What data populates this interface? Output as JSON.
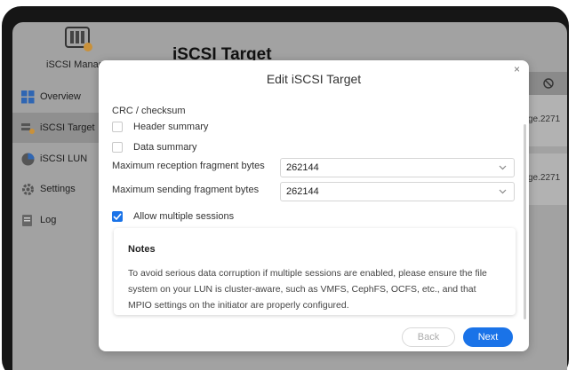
{
  "app": {
    "name": "iSCSI Manager",
    "page_title": "iSCSI Target"
  },
  "sidebar": {
    "items": [
      {
        "label": "Overview",
        "icon": "grid-icon"
      },
      {
        "label": "iSCSI Target",
        "icon": "target-icon",
        "active": true
      },
      {
        "label": "iSCSI LUN",
        "icon": "pie-icon"
      },
      {
        "label": "Settings",
        "icon": "gear-icon"
      },
      {
        "label": "Log",
        "icon": "log-icon"
      }
    ]
  },
  "background_list": {
    "rows": [
      "ge.2271",
      "ge.2271"
    ]
  },
  "dialog": {
    "title": "Edit iSCSI Target",
    "close_glyph": "×",
    "section_label": "CRC / checksum",
    "header_summary": {
      "label": "Header summary",
      "checked": false
    },
    "data_summary": {
      "label": "Data summary",
      "checked": false
    },
    "max_reception": {
      "label": "Maximum reception fragment bytes",
      "value": "262144"
    },
    "max_sending": {
      "label": "Maximum sending fragment bytes",
      "value": "262144"
    },
    "allow_multiple": {
      "label": "Allow multiple sessions",
      "checked": true
    },
    "notes": {
      "title": "Notes",
      "body": "To avoid serious data corruption if multiple sessions are enabled, please ensure the file system on your LUN is cluster-aware, such as VMFS, CephFS, OCFS, etc., and that MPIO settings on the initiator are properly configured."
    },
    "back_label": "Back",
    "next_label": "Next"
  },
  "colors": {
    "accent": "#1a73e8",
    "overlay": "#a2a2a2",
    "frame": "#161616"
  }
}
